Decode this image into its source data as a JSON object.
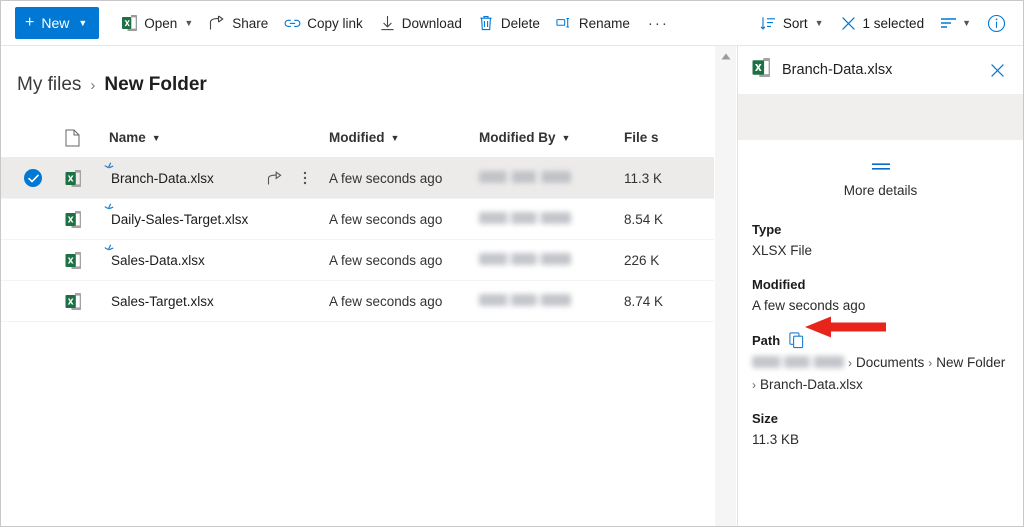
{
  "toolbar": {
    "new_button": {
      "label": "New",
      "icon": "plus-icon",
      "chevron": "chevron-down-icon"
    },
    "items": [
      {
        "label": "Open",
        "icon": "excel-icon",
        "has_chevron": true
      },
      {
        "label": "Share",
        "icon": "share-icon",
        "has_chevron": false
      },
      {
        "label": "Copy link",
        "icon": "link-icon",
        "has_chevron": false
      },
      {
        "label": "Download",
        "icon": "download-icon",
        "has_chevron": false
      },
      {
        "label": "Delete",
        "icon": "trash-icon",
        "has_chevron": false
      },
      {
        "label": "Rename",
        "icon": "rename-icon",
        "has_chevron": false
      }
    ],
    "overflow_label": "···",
    "sort": {
      "label": "Sort",
      "icon": "sort-icon",
      "chevron": "chevron-down-icon"
    },
    "selection": {
      "label": "1 selected",
      "icon": "close-icon"
    },
    "view_options": {
      "icon": "view-options-icon",
      "chevron": "chevron-down-icon"
    },
    "info": {
      "icon": "info-icon"
    }
  },
  "breadcrumb": {
    "root": "My files",
    "separator": "›",
    "current": "New Folder"
  },
  "file_list": {
    "columns": [
      {
        "key": "name",
        "label": "Name",
        "sortable": true
      },
      {
        "key": "modified",
        "label": "Modified",
        "sortable": true
      },
      {
        "key": "modified_by",
        "label": "Modified By",
        "sortable": true
      },
      {
        "key": "size",
        "label": "File s",
        "sortable": false
      }
    ],
    "rows": [
      {
        "name": "Branch-Data.xlsx",
        "modified": "A few seconds ago",
        "modified_by": "",
        "size": "11.3 K",
        "selected": true,
        "is_new": true,
        "icon": "excel-file-icon"
      },
      {
        "name": "Daily-Sales-Target.xlsx",
        "modified": "A few seconds ago",
        "modified_by": "",
        "size": "8.54 K",
        "selected": false,
        "is_new": true,
        "icon": "excel-file-icon"
      },
      {
        "name": "Sales-Data.xlsx",
        "modified": "A few seconds ago",
        "modified_by": "",
        "size": "226 K",
        "selected": false,
        "is_new": true,
        "icon": "excel-file-icon"
      },
      {
        "name": "Sales-Target.xlsx",
        "modified": "A few seconds ago",
        "modified_by": "",
        "size": "8.74 K",
        "selected": false,
        "is_new": false,
        "icon": "excel-file-icon"
      }
    ],
    "row_actions": {
      "share": "share-icon",
      "more": "more-vertical-icon"
    }
  },
  "details_pane": {
    "title": "Branch-Data.xlsx",
    "file_icon": "excel-file-icon",
    "close_icon": "close-icon",
    "more_details_label": "More details",
    "fields": [
      {
        "key": "Type",
        "value": "XLSX File"
      },
      {
        "key": "Modified",
        "value": "A few seconds ago"
      }
    ],
    "path": {
      "label": "Path",
      "copy_icon": "copy-icon",
      "segments": [
        "Documents",
        "New Folder",
        "Branch-Data.xlsx"
      ],
      "separator": "›"
    },
    "size": {
      "label": "Size",
      "value": "11.3 KB"
    }
  },
  "annotation": {
    "type": "arrow",
    "color": "#e8251c",
    "points_to": "path-copy-icon"
  },
  "colors": {
    "accent": "#0078d4",
    "excel_green": "#1d7044",
    "selected_row": "#edebe9",
    "annotation_red": "#e8251c"
  }
}
